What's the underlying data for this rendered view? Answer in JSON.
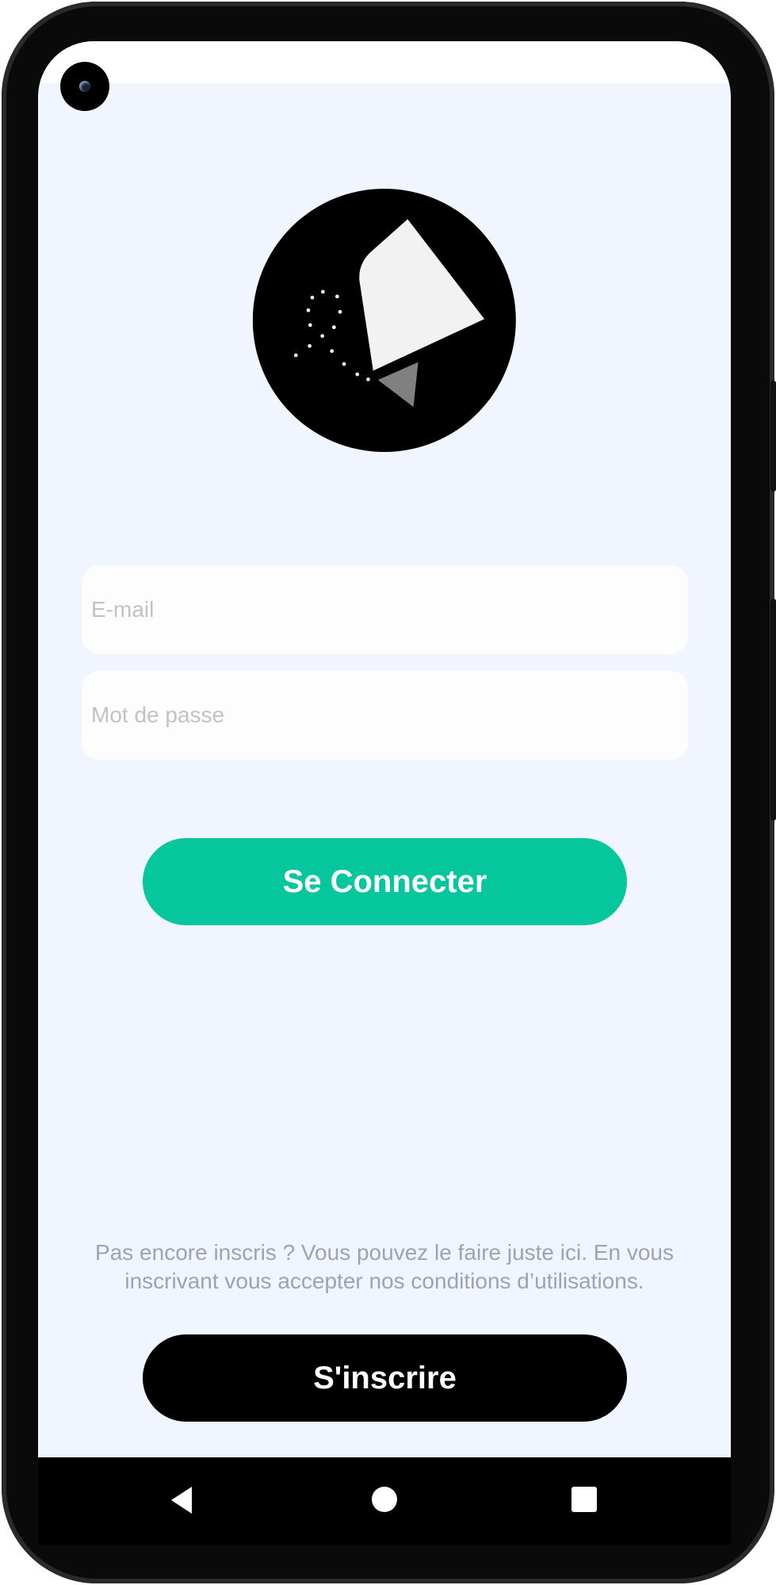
{
  "login": {
    "email_placeholder": "E-mail",
    "password_placeholder": "Mot de passe",
    "login_button": "Se Connecter"
  },
  "signup": {
    "info_text": "Pas encore inscris ? Vous pouvez le faire juste ici. En vous inscrivant vous accepter nos conditions d’utilisations.",
    "signup_button": "S'inscrire"
  },
  "colors": {
    "background": "#f0f5ff",
    "primary": "#05c69d",
    "secondary": "#000000"
  },
  "nav": {
    "icons": [
      "back-icon",
      "home-icon",
      "recents-icon"
    ]
  }
}
